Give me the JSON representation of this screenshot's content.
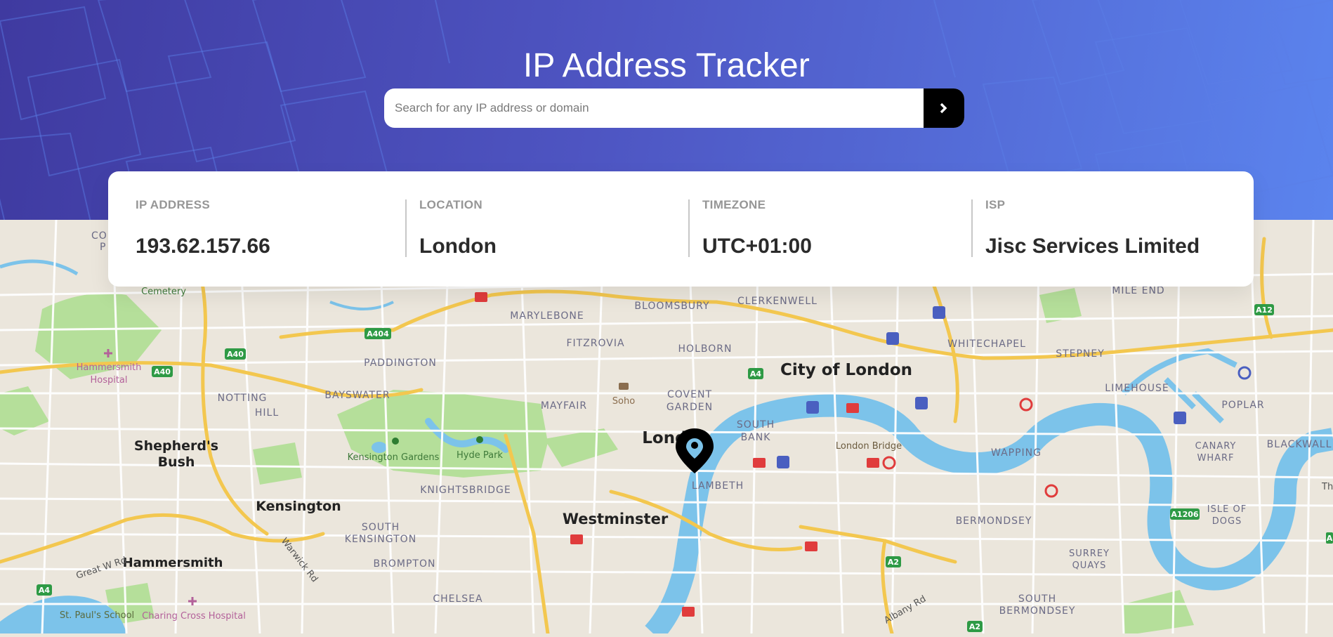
{
  "header": {
    "title": "IP Address Tracker",
    "search_placeholder": "Search for any IP address or domain",
    "submit_icon": "chevron-right-icon"
  },
  "stats": [
    {
      "label": "IP ADDRESS",
      "value": "193.62.157.66"
    },
    {
      "label": "LOCATION",
      "value": "London"
    },
    {
      "label": "TIMEZONE",
      "value": "UTC+01:00"
    },
    {
      "label": "ISP",
      "value": "Jisc Services Limited"
    }
  ],
  "map": {
    "marker_icon": "location-pin-icon",
    "labels": {
      "cemetery": "Cemetery",
      "hammersmith_hospital": "Hammersmith Hospital",
      "hammersmith_hospital_l1": "Hammersmith",
      "hammersmith_hospital_l2": "Hospital",
      "col_l1": "COL",
      "col_l2": "P",
      "shepherds_bush_l1": "Shepherd's",
      "shepherds_bush_l2": "Bush",
      "notting_hill_l1": "NOTTING",
      "notting_hill_l2": "HILL",
      "paddington": "PADDINGTON",
      "bayswater": "BAYSWATER",
      "marylebone": "MARYLEBONE",
      "fitzrovia": "FITZROVIA",
      "bloomsbury": "BLOOMSBURY",
      "clerkenwell": "CLERKENWELL",
      "holborn": "HOLBORN",
      "mayfair": "MAYFAIR",
      "soho": "Soho",
      "covent_garden_l1": "COVENT",
      "covent_garden_l2": "GARDEN",
      "city_of_london": "City of London",
      "whitechapel": "WHITECHAPEL",
      "stepney": "STEPNEY",
      "mile_end": "MILE END",
      "limehouse": "LIMEHOUSE",
      "poplar": "POPLAR",
      "blackwall": "BLACKWALL",
      "canary_wharf_l1": "CANARY",
      "canary_wharf_l2": "WHARF",
      "wapping": "WAPPING",
      "london_bridge": "London Bridge",
      "south_bank_l1": "SOUTH",
      "south_bank_l2": "BANK",
      "lambeth": "LAMBETH",
      "london": "London",
      "kensington_gardens": "Kensington Gardens",
      "hyde_park": "Hyde Park",
      "knightsbridge": "KNIGHTSBRIDGE",
      "westminster": "Westminster",
      "kensington": "Kensington",
      "south_kensington_l1": "SOUTH",
      "south_kensington_l2": "KENSINGTON",
      "brompton": "BROMPTON",
      "chelsea": "CHELSEA",
      "hammersmith": "Hammersmith",
      "great_w_rd": "Great W Rd",
      "warwick_rd": "Warwick Rd",
      "st_pauls_school": "St. Paul's School",
      "charing_cross_hospital": "Charing Cross Hospital",
      "bermondsey": "BERMONDSEY",
      "surrey_quays_l1": "SURREY",
      "surrey_quays_l2": "QUAYS",
      "isle_of_dogs_l1": "ISLE OF",
      "isle_of_dogs_l2": "DOGS",
      "south_bermondsey_l1": "SOUTH",
      "south_bermondsey_l2": "BERMONDSEY",
      "albany_rd": "Albany Rd",
      "the": "Th"
    },
    "road_shields": [
      "A404",
      "A40",
      "A40",
      "A4",
      "A4",
      "A2",
      "A2",
      "A12",
      "A1206",
      "A"
    ]
  },
  "colors": {
    "gradient_start": "#3f3aa0",
    "gradient_end": "#5b84ee",
    "card_bg": "#ffffff",
    "label_gray": "#969696",
    "value_dark": "#2b2b2b",
    "button_bg": "#000000",
    "river": "#7cc3ea",
    "park": "#b5df9a",
    "map_bg": "#ebe6dc",
    "road_major": "#f3c74f"
  }
}
